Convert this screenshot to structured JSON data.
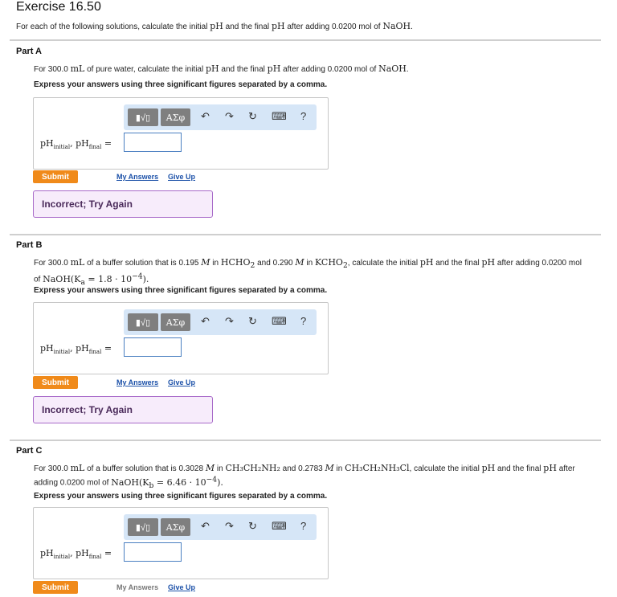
{
  "exercise_title": "Exercise 16.50",
  "intro": {
    "pre": "For each of the following solutions, calculate the initial ",
    "ph1": "pH",
    "mid1": " and the final ",
    "ph2": "pH",
    "mid2": " after adding 0.0200 mol of ",
    "naoh": "NaOH",
    "end": "."
  },
  "toolbar": {
    "templates_label": "▮√▯",
    "symbols_label": "ΑΣφ",
    "undo": "↶",
    "redo": "↷",
    "reset": "↻",
    "keyboard": "⌨",
    "help": "?"
  },
  "answer_label": {
    "a": "pH",
    "a_sub": "initial",
    "sep": ", ",
    "b": "pH",
    "b_sub": "final",
    "eq": " ="
  },
  "express": "Express your answers using three significant figures separated by a comma.",
  "submit_label": "Submit",
  "my_answers_label": "My Answers",
  "give_up_label": "Give Up",
  "feedback_text": "Incorrect; Try Again",
  "parts": {
    "a": {
      "title": "Part A",
      "q_1": "For 300.0 ",
      "q_ml": "mL",
      "q_2": " of pure water, calculate the initial ",
      "q_ph1": "pH",
      "q_3": " and the final ",
      "q_ph2": "pH",
      "q_4": " after adding 0.0200 mol of ",
      "q_naoh": "NaOH",
      "q_5": "."
    },
    "b": {
      "title": "Part B",
      "q_1": "For 300.0 ",
      "q_ml": "mL",
      "q_2": " of a buffer solution that is 0.195 ",
      "q_m1": "M",
      "q_3": " in ",
      "q_acid": "HCHO",
      "q_acid_sub": "2",
      "q_4": " and 0.290 ",
      "q_m2": "M",
      "q_5": " in ",
      "q_salt": "KCHO",
      "q_salt_sub": "2",
      "q_6": ", calculate the initial ",
      "q_ph1": "pH",
      "q_7": " and the final ",
      "q_ph2": "pH",
      "q_8": " after adding 0.0200 mol",
      "q_9": "of ",
      "q_naoh": "NaOH(K",
      "q_k_sub": "a",
      "q_kval": " = 1.8 · 10",
      "q_exp": "−4",
      "q_10": ")."
    },
    "c": {
      "title": "Part C",
      "q_1": "For 300.0 ",
      "q_ml": "mL",
      "q_2": " of a buffer solution that is 0.3028 ",
      "q_m1": "M",
      "q_3": " in ",
      "q_base": "CH₃CH₂NH₂",
      "q_4": " and 0.2783 ",
      "q_m2": "M",
      "q_5": " in ",
      "q_salt": "CH₃CH₂NH₃Cl",
      "q_6": ", calculate the initial ",
      "q_ph1": "pH",
      "q_7": " and the final ",
      "q_ph2": "pH",
      "q_8": " after",
      "q_9": "adding 0.0200 mol of ",
      "q_naoh": "NaOH(K",
      "q_k_sub": "b",
      "q_kval": " = 6.46 · 10",
      "q_exp": "−4",
      "q_10": ")."
    }
  },
  "colors": {
    "submit_orange": "#f08a1a",
    "toolbar_blue": "#d6e6f7",
    "link_blue": "#1b50a8",
    "feedback_bg": "#f7ecfb",
    "feedback_border": "#a86ac9"
  }
}
